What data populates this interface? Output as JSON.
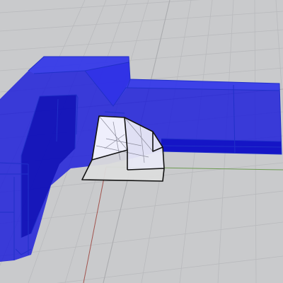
{
  "viewport": {
    "projection": "perspective",
    "display_mode": "x-ray",
    "background_color": "#c9cacc",
    "grid_color": "#b9babd",
    "grid_major_color": "#a9aaad",
    "x_axis_color": "#6d9a52",
    "y_axis_color": "#a2544e"
  },
  "objects": [
    {
      "name": "blue-polysurface",
      "color": "#1a1adb",
      "selected": false
    },
    {
      "name": "selected-corner-block",
      "color": "#ffffff",
      "selected": true
    }
  ]
}
